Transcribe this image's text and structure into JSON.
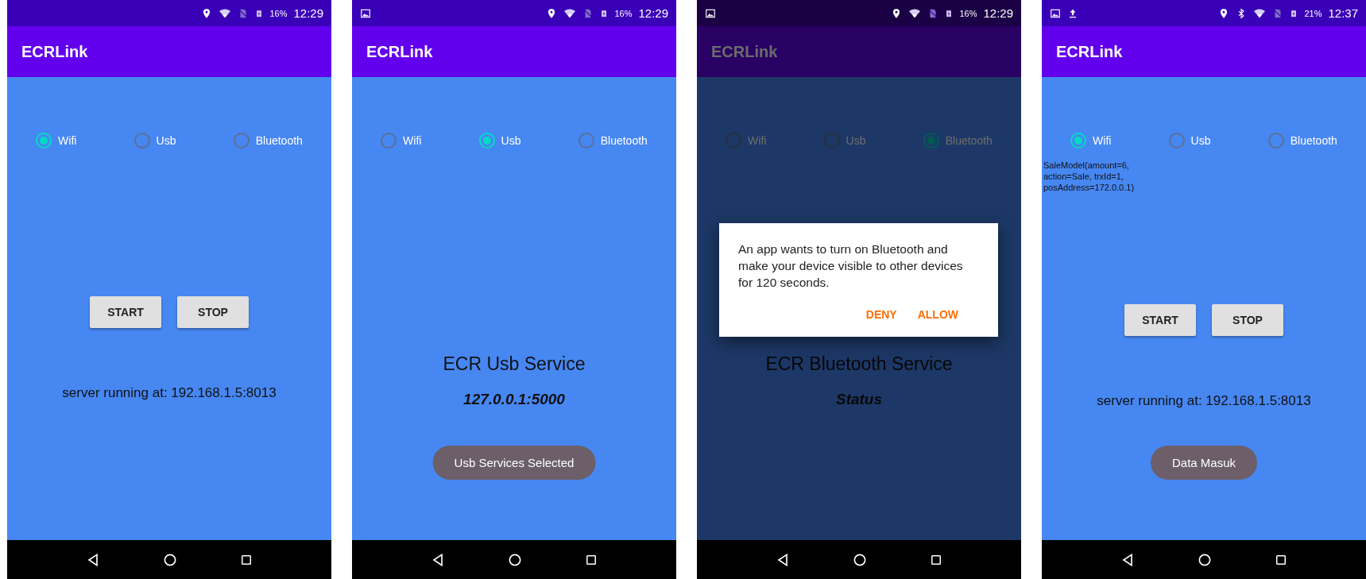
{
  "screens": [
    {
      "status_bar": {
        "bluetooth": false,
        "battery": "16%",
        "time": "12:29"
      },
      "app_title": "ECRLink",
      "dimmed": false,
      "radios": [
        {
          "label": "Wifi",
          "selected": true
        },
        {
          "label": "Usb",
          "selected": false
        },
        {
          "label": "Bluetooth",
          "selected": false
        }
      ],
      "content": [
        {
          "kind": "buttons",
          "labels": [
            "START",
            "STOP"
          ]
        },
        {
          "kind": "server",
          "text": "server running at: 192.168.1.5:8013"
        }
      ]
    },
    {
      "status_bar": {
        "notification_icons": [
          {
            "kind": "image"
          }
        ],
        "bluetooth": false,
        "battery": "16%",
        "time": "12:29"
      },
      "app_title": "ECRLink",
      "dimmed": false,
      "radios": [
        {
          "label": "Wifi",
          "selected": false
        },
        {
          "label": "Usb",
          "selected": true
        },
        {
          "label": "Bluetooth",
          "selected": false
        }
      ],
      "content": [
        {
          "kind": "title",
          "text": "ECR Usb Service"
        },
        {
          "kind": "address",
          "text": "127.0.0.1:5000"
        }
      ],
      "toast": "Usb Services Selected"
    },
    {
      "status_bar": {
        "notification_icons": [
          {
            "kind": "image"
          }
        ],
        "bluetooth": false,
        "battery": "16%",
        "time": "12:29"
      },
      "app_title": "ECRLink",
      "dimmed": true,
      "radios": [
        {
          "label": "Wifi",
          "selected": false
        },
        {
          "label": "Usb",
          "selected": false
        },
        {
          "label": "Bluetooth",
          "selected": true
        }
      ],
      "content": [
        {
          "kind": "title",
          "text": "ECR Bluetooth Service"
        },
        {
          "kind": "address",
          "text": "Status"
        }
      ],
      "dialog": {
        "message": "An app wants to turn on Bluetooth and make your device visible to other devices for 120 seconds.",
        "actions": [
          "DENY",
          "ALLOW"
        ]
      }
    },
    {
      "status_bar": {
        "notification_icons": [
          {
            "kind": "image"
          },
          {
            "kind": "upload"
          }
        ],
        "bluetooth": true,
        "battery": "21%",
        "time": "12:37"
      },
      "app_title": "ECRLink",
      "dimmed": false,
      "radios": [
        {
          "label": "Wifi",
          "selected": true
        },
        {
          "label": "Usb",
          "selected": false
        },
        {
          "label": "Bluetooth",
          "selected": false
        }
      ],
      "content": [
        {
          "kind": "info",
          "text": "SaleModel(amount=6, action=Sale, trxId=1, posAddress=172.0.0.1)"
        },
        {
          "kind": "buttons",
          "labels": [
            "START",
            "STOP"
          ]
        },
        {
          "kind": "server",
          "text": "server running at: 192.168.1.5:8013"
        }
      ],
      "toast": "Data Masuk"
    }
  ]
}
